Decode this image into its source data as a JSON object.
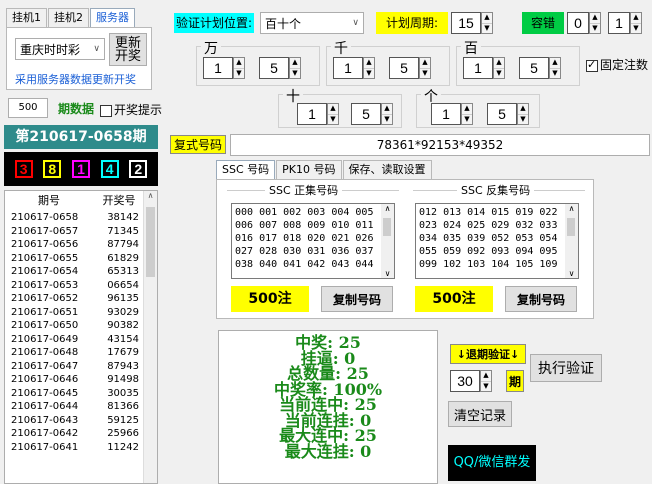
{
  "tabs": [
    "挂机1",
    "挂机2",
    "服务器"
  ],
  "server_panel": {
    "lottery_select": "重庆时时彩",
    "update_button": "更新开奖",
    "info_text": "采用服务器数据更新开奖"
  },
  "period_data": {
    "count_value": "500",
    "label": "期数据",
    "notify_label": "开奖提示"
  },
  "current_period": "第210617-0658期",
  "balls": [
    "3",
    "8",
    "1",
    "4",
    "2"
  ],
  "ball_colors": [
    "#ff0000",
    "#ffff00",
    "#ff00ff",
    "#00ffff",
    "#ffffff"
  ],
  "history": {
    "headers": [
      "期号",
      "开奖号"
    ],
    "rows": [
      [
        "210617-0658",
        "38142"
      ],
      [
        "210617-0657",
        "71345"
      ],
      [
        "210617-0656",
        "87794"
      ],
      [
        "210617-0655",
        "61829"
      ],
      [
        "210617-0654",
        "65313"
      ],
      [
        "210617-0653",
        "06654"
      ],
      [
        "210617-0652",
        "96135"
      ],
      [
        "210617-0651",
        "93029"
      ],
      [
        "210617-0650",
        "90382"
      ],
      [
        "210617-0649",
        "43154"
      ],
      [
        "210617-0648",
        "17679"
      ],
      [
        "210617-0647",
        "87943"
      ],
      [
        "210617-0646",
        "91498"
      ],
      [
        "210617-0645",
        "30035"
      ],
      [
        "210617-0644",
        "81366"
      ],
      [
        "210617-0643",
        "59125"
      ],
      [
        "210617-0642",
        "25966"
      ],
      [
        "210617-0641",
        "11242"
      ]
    ]
  },
  "verify": {
    "position_label": "验证计划位置:",
    "position_value": "百十个",
    "cycle_label": "计划周期:",
    "cycle_value": "15",
    "tolerance_label": "容错",
    "tolerance_value1": "0",
    "tolerance_value2": "1",
    "fixed_label": "固定注数"
  },
  "digits": {
    "wan": {
      "label": "万",
      "a": "1",
      "b": "5"
    },
    "qian": {
      "label": "千",
      "a": "1",
      "b": "5"
    },
    "bai": {
      "label": "百",
      "a": "1",
      "b": "5"
    },
    "shi": {
      "label": "十",
      "a": "1",
      "b": "5"
    },
    "ge": {
      "label": "个",
      "a": "1",
      "b": "5"
    }
  },
  "compound": {
    "label": "复式号码",
    "value": "78361*92153*49352"
  },
  "code_tabs": [
    "SSC 号码",
    "PK10 号码",
    "保存、读取设置"
  ],
  "positive_set": {
    "title": "SSC 正集号码",
    "text": "000 001 002 003 004 005\n006 007 008 009 010 011\n016 017 018 020 021 026\n027 028 030 031 036 037\n038 040 041 042 043 044",
    "count": "500注",
    "copy": "复制号码"
  },
  "negative_set": {
    "title": "SSC 反集号码",
    "text": "012 013 014 015 019 022\n023 024 025 029 032 033\n034 035 039 052 053 054\n055 059 092 093 094 095\n099 102 103 104 105 109",
    "count": "500注",
    "copy": "复制号码"
  },
  "stats": [
    "中奖: 25",
    "挂逼: 0",
    "总数量: 25",
    "中奖率: 100%",
    "当前连中: 25",
    "当前连挂: 0",
    "最大连中: 25",
    "最大连挂: 0"
  ],
  "actions": {
    "back_verify_label": "↓退期验证↓",
    "back_value": "30",
    "back_unit": "期",
    "execute": "执行验证",
    "clear": "清空记录",
    "qq": "QQ/微信群发"
  }
}
